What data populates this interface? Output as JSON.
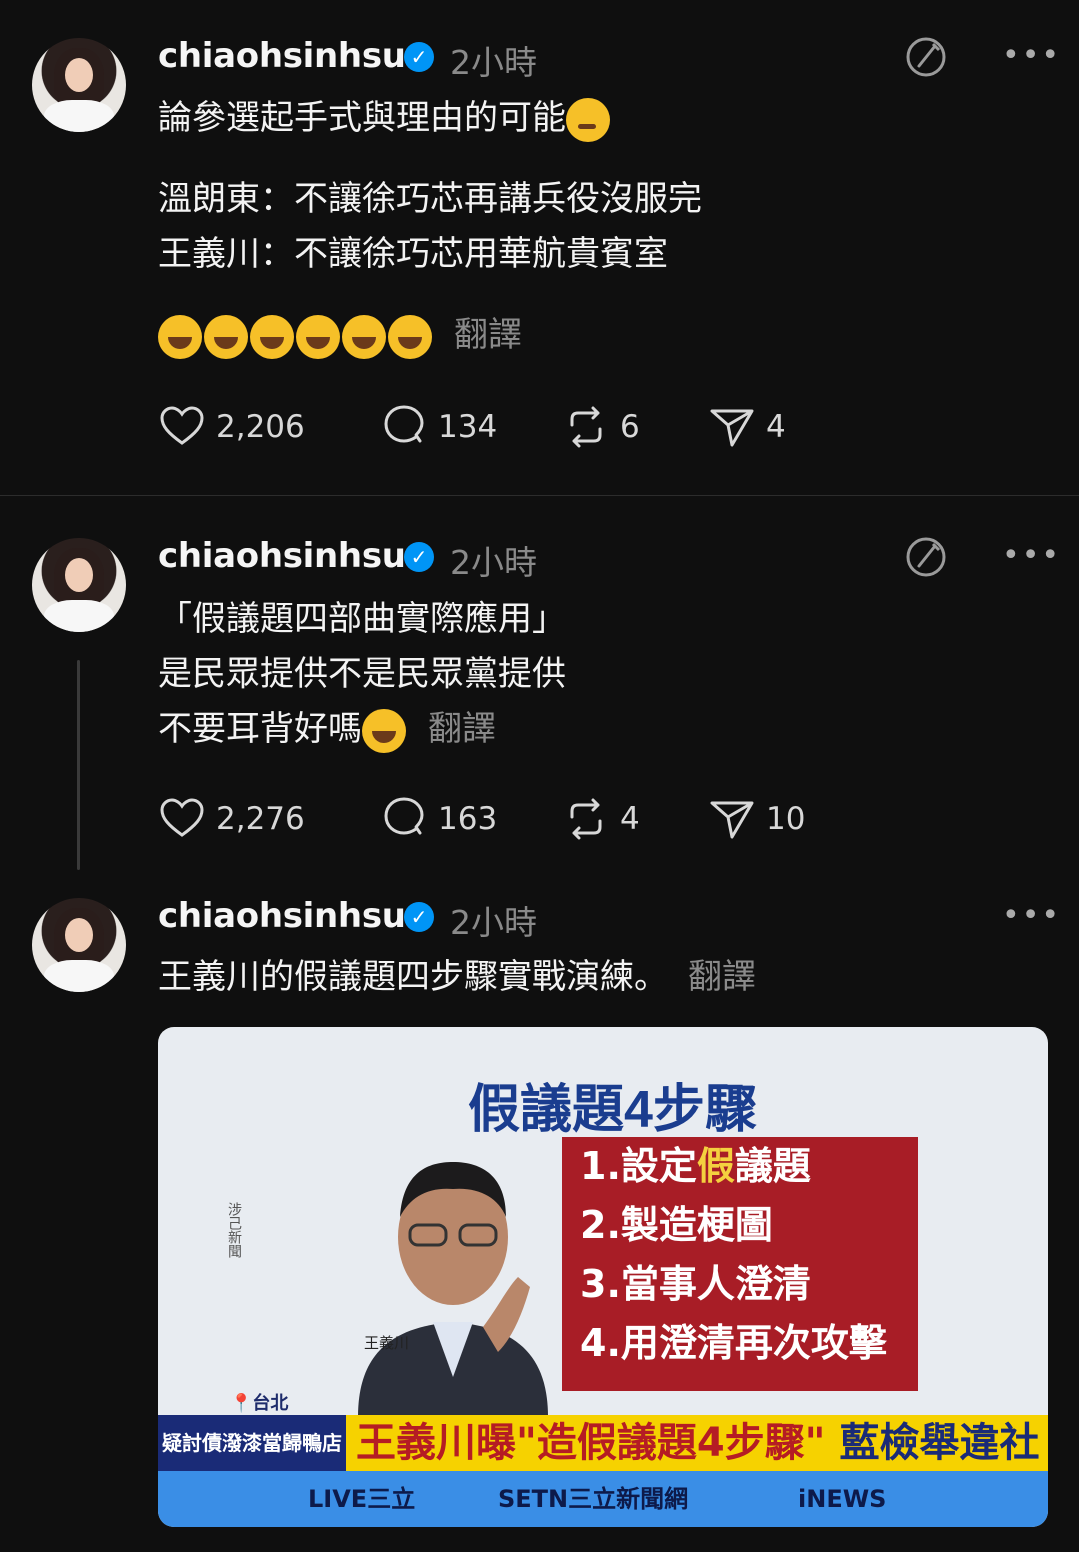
{
  "posts": [
    {
      "username": "chiaohsinhsu",
      "time": "2小時",
      "lines": [
        "論參選起手式與理由的可能",
        "溫朗東：不讓徐巧芯再講兵役沒服完",
        "王義川：不讓徐巧芯用華航貴賓室"
      ],
      "translate": "翻譯",
      "likes": "2,206",
      "comments": "134",
      "reposts": "6",
      "shares": "4"
    },
    {
      "username": "chiaohsinhsu",
      "time": "2小時",
      "lines": [
        "「假議題四部曲實際應用」",
        "是民眾提供不是民眾黨提供",
        "不要耳背好嗎"
      ],
      "translate": "翻譯",
      "likes": "2,276",
      "comments": "163",
      "reposts": "4",
      "shares": "10"
    },
    {
      "username": "chiaohsinhsu",
      "time": "2小時",
      "lines": [
        "王義川的假議題四步驟實戰演練。"
      ],
      "translate": "翻譯",
      "media": {
        "title": "假議題4步驟",
        "steps": [
          "1.設定",
          "假",
          "議題",
          "2.製造梗圖",
          "3.當事人澄清",
          "4.用澄清再次攻擊"
        ],
        "person_name": "王義川",
        "vertical_text": "涉己新聞",
        "location": "台北",
        "ticker_left": "疑討債潑漆當歸鴨店",
        "ticker_main_a": "王義川曝\"造假議題4步驟\"",
        "ticker_main_b": "藍檢舉違社維法",
        "bottom_1": "LIVE三立",
        "bottom_2": "SETN三立新聞網",
        "bottom_3": "iNEWS"
      }
    }
  ]
}
